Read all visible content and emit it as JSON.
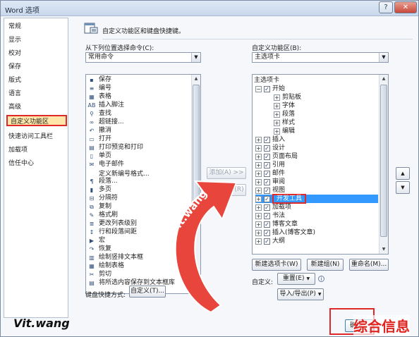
{
  "window": {
    "title": "Word 选项",
    "help_glyph": "?",
    "close_glyph": "✕"
  },
  "nav": {
    "items": [
      {
        "label": "常规"
      },
      {
        "label": "显示"
      },
      {
        "label": "校对"
      },
      {
        "label": "保存"
      },
      {
        "label": "版式"
      },
      {
        "label": "语言"
      },
      {
        "label": "高级"
      },
      {
        "label": "自定义功能区",
        "selected": true
      },
      {
        "label": "快速访问工具栏"
      },
      {
        "label": "加载项"
      },
      {
        "label": "信任中心"
      }
    ]
  },
  "header": {
    "text": "自定义功能区和键盘快捷键。"
  },
  "left_panel": {
    "label": "从下列位置选择命令(C):",
    "combo_value": "常用命令",
    "commands": [
      {
        "label": "保存",
        "icon": "save-icon",
        "glyph": "▪"
      },
      {
        "label": "编号",
        "icon": "numbering-icon",
        "glyph": "≡",
        "submenu": true
      },
      {
        "label": "表格",
        "icon": "table-icon",
        "glyph": "▦",
        "submenu": true
      },
      {
        "label": "插入脚注",
        "icon": "footnote-icon",
        "glyph": "AB"
      },
      {
        "label": "查找",
        "icon": "find-icon",
        "glyph": "⚲"
      },
      {
        "label": "超链接...",
        "icon": "hyperlink-icon",
        "glyph": "∞"
      },
      {
        "label": "撤消",
        "icon": "undo-icon",
        "glyph": "↶",
        "submenu": true
      },
      {
        "label": "打开",
        "icon": "open-icon",
        "glyph": "▭"
      },
      {
        "label": "打印预览和打印",
        "icon": "print-preview-icon",
        "glyph": "▤"
      },
      {
        "label": "单页",
        "icon": "single-page-icon",
        "glyph": "▯"
      },
      {
        "label": "电子邮件",
        "icon": "email-icon",
        "glyph": "✉"
      },
      {
        "label": "定义新编号格式...",
        "icon": "",
        "glyph": ""
      },
      {
        "label": "段落...",
        "icon": "paragraph-icon",
        "glyph": "¶"
      },
      {
        "label": "多页",
        "icon": "multi-page-icon",
        "glyph": "▮"
      },
      {
        "label": "分隔符",
        "icon": "separator-icon",
        "glyph": "⊟",
        "submenu": true
      },
      {
        "label": "复制",
        "icon": "copy-icon",
        "glyph": "⧉"
      },
      {
        "label": "格式刷",
        "icon": "format-painter-icon",
        "glyph": "✎"
      },
      {
        "label": "更改列表级别",
        "icon": "list-level-icon",
        "glyph": "≣"
      },
      {
        "label": "行和段落间距",
        "icon": "line-spacing-icon",
        "glyph": "↕"
      },
      {
        "label": "宏",
        "icon": "macro-icon",
        "glyph": "▶"
      },
      {
        "label": "恢复",
        "icon": "redo-icon",
        "glyph": "↷"
      },
      {
        "label": "绘制竖排文本框",
        "icon": "vertical-textbox-icon",
        "glyph": "▥"
      },
      {
        "label": "绘制表格",
        "icon": "draw-table-icon",
        "glyph": "▦"
      },
      {
        "label": "剪切",
        "icon": "cut-icon",
        "glyph": "✂"
      },
      {
        "label": "将所选内容保存到文本框库",
        "icon": "textbox-gallery-icon",
        "glyph": "▤"
      }
    ],
    "keyboard_label": "键盘快捷方式:",
    "customize_btn": "自定义(T)..."
  },
  "middle": {
    "add_btn": "添加(A) >>",
    "remove_btn": "<< 删除(R)"
  },
  "right_panel": {
    "label": "自定义功能区(B):",
    "combo_value": "主选项卡",
    "tree": [
      {
        "label": "主选项卡",
        "level": 0,
        "type": "header"
      },
      {
        "label": "开始",
        "level": 1,
        "type": "tab",
        "expand": "⊟",
        "checked": true
      },
      {
        "label": "剪贴板",
        "level": 2,
        "type": "group",
        "expand": "⊞"
      },
      {
        "label": "字体",
        "level": 2,
        "type": "group",
        "expand": "⊞"
      },
      {
        "label": "段落",
        "level": 2,
        "type": "group",
        "expand": "⊞"
      },
      {
        "label": "样式",
        "level": 2,
        "type": "group",
        "expand": "⊞"
      },
      {
        "label": "编辑",
        "level": 2,
        "type": "group",
        "expand": "⊞"
      },
      {
        "label": "插入",
        "level": 1,
        "type": "tab",
        "expand": "⊞",
        "checked": true
      },
      {
        "label": "设计",
        "level": 1,
        "type": "tab",
        "expand": "⊞",
        "checked": true
      },
      {
        "label": "页面布局",
        "level": 1,
        "type": "tab",
        "expand": "⊞",
        "checked": true
      },
      {
        "label": "引用",
        "level": 1,
        "type": "tab",
        "expand": "⊞",
        "checked": true
      },
      {
        "label": "邮件",
        "level": 1,
        "type": "tab",
        "expand": "⊞",
        "checked": true
      },
      {
        "label": "审阅",
        "level": 1,
        "type": "tab",
        "expand": "⊞",
        "checked": true
      },
      {
        "label": "视图",
        "level": 1,
        "type": "tab",
        "expand": "⊞",
        "checked": true
      },
      {
        "label": "开发工具",
        "level": 1,
        "type": "tab",
        "expand": "⊞",
        "checked": true,
        "selected": true
      },
      {
        "label": "加载项",
        "level": 1,
        "type": "tab",
        "expand": "⊞",
        "checked": true
      },
      {
        "label": "书法",
        "level": 1,
        "type": "tab",
        "expand": "⊞",
        "checked": true
      },
      {
        "label": "博客文章",
        "level": 1,
        "type": "tab",
        "expand": "⊞",
        "checked": true
      },
      {
        "label": "插入(博客文章)",
        "level": 1,
        "type": "tab",
        "expand": "⊞",
        "checked": true
      },
      {
        "label": "大纲",
        "level": 1,
        "type": "tab",
        "expand": "⊞",
        "checked": true
      }
    ],
    "new_tab_btn": "新建选项卡(W)",
    "new_group_btn": "新建组(N)",
    "rename_btn": "重命名(M)...",
    "customize_label": "自定义:",
    "reset_btn": "重置(E)",
    "import_export_btn": "导入/导出(P)",
    "move_up_glyph": "▲",
    "move_down_glyph": "▼"
  },
  "footer": {
    "ok_btn": "确定"
  },
  "watermarks": {
    "vit_corner": "Vit.wang",
    "vit_arrow": "vit.wang",
    "brand": "综合信息"
  },
  "colors": {
    "selected_row": "#3399ff",
    "highlight_box": "#e02828",
    "nav_selected_bg": "#fde6a8"
  }
}
